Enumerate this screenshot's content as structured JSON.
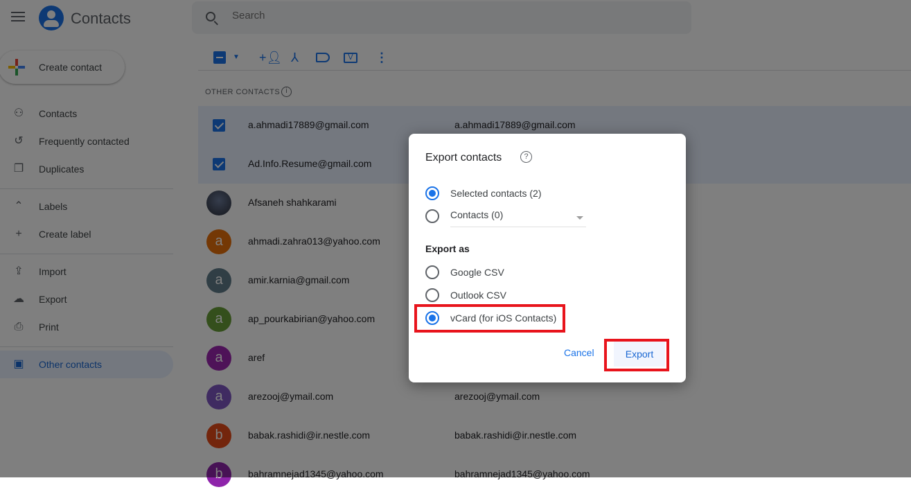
{
  "header": {
    "title": "Contacts",
    "search_placeholder": "Search"
  },
  "sidebar": {
    "create_label": "Create contact",
    "items": [
      {
        "label": "Contacts",
        "icon": "person-icon"
      },
      {
        "label": "Frequently contacted",
        "icon": "history-icon"
      },
      {
        "label": "Duplicates",
        "icon": "copy-icon"
      },
      {
        "label": "Labels",
        "icon": "chevron-up-icon"
      },
      {
        "label": "Create label",
        "icon": "plus-icon"
      },
      {
        "label": "Import",
        "icon": "upload-icon"
      },
      {
        "label": "Export",
        "icon": "cloud-download-icon"
      },
      {
        "label": "Print",
        "icon": "print-icon"
      },
      {
        "label": "Other contacts",
        "icon": "archive-icon",
        "active": true
      }
    ]
  },
  "section_title": "OTHER CONTACTS",
  "rows": [
    {
      "name": "a.ahmadi17889@gmail.com",
      "email": "a.ahmadi17889@gmail.com",
      "selected": true
    },
    {
      "name": "Ad.Info.Resume@gmail.com",
      "email": "",
      "selected": true
    },
    {
      "name": "Afsaneh shahkarami",
      "email": "",
      "photo": true
    },
    {
      "name": "ahmadi.zahra013@yahoo.com",
      "email": "",
      "initial": "a",
      "color": "#e8710a"
    },
    {
      "name": "amir.karnia@gmail.com",
      "email": "",
      "initial": "a",
      "color": "#607d8b"
    },
    {
      "name": "ap_pourkabirian@yahoo.com",
      "email": "",
      "initial": "a",
      "color": "#689f38"
    },
    {
      "name": "aref",
      "email": "",
      "initial": "a",
      "color": "#9c27b0"
    },
    {
      "name": "arezooj@ymail.com",
      "email": "arezooj@ymail.com",
      "initial": "a",
      "color": "#7e57c2"
    },
    {
      "name": "babak.rashidi@ir.nestle.com",
      "email": "babak.rashidi@ir.nestle.com",
      "initial": "b",
      "color": "#e64a19"
    },
    {
      "name": "bahramnejad1345@yahoo.com",
      "email": "bahramnejad1345@yahoo.com",
      "initial": "b",
      "color": "#8e24aa"
    }
  ],
  "dialog": {
    "title": "Export contacts",
    "selected_label": "Selected contacts (2)",
    "contacts_label": "Contacts (0)",
    "export_as": "Export as",
    "formats": [
      "Google CSV",
      "Outlook CSV",
      "vCard (for iOS Contacts)"
    ],
    "selected_format": "vCard (for iOS Contacts)",
    "cancel": "Cancel",
    "export": "Export"
  },
  "colors": {
    "accent": "#1a73e8",
    "highlight": "#e8141c"
  }
}
